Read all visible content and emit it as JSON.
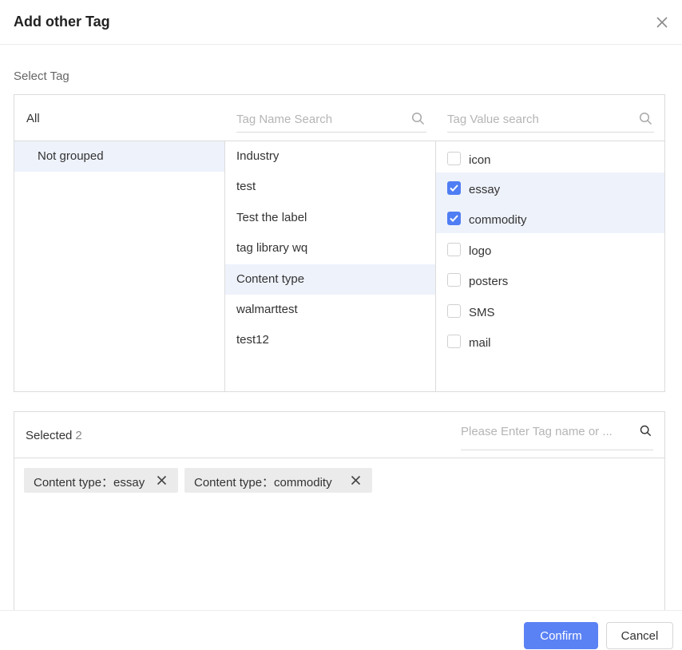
{
  "dialog": {
    "title": "Add other Tag",
    "close_icon": "close-icon"
  },
  "select_tag": {
    "label": "Select Tag",
    "all_label": "All",
    "name_search_placeholder": "Tag Name Search",
    "value_search_placeholder": "Tag Value search",
    "groups": [
      {
        "label": "Not grouped",
        "active": true
      }
    ],
    "tag_names": [
      {
        "label": "Industry",
        "active": false
      },
      {
        "label": "test",
        "active": false
      },
      {
        "label": "Test the label",
        "active": false
      },
      {
        "label": "tag library wq",
        "active": false
      },
      {
        "label": "Content type",
        "active": true
      },
      {
        "label": "walmarttest",
        "active": false
      },
      {
        "label": "test12",
        "active": false
      }
    ],
    "tag_values": [
      {
        "label": "icon",
        "checked": false
      },
      {
        "label": "essay",
        "checked": true
      },
      {
        "label": "commodity",
        "checked": true
      },
      {
        "label": "logo",
        "checked": false
      },
      {
        "label": "posters",
        "checked": false
      },
      {
        "label": "SMS",
        "checked": false
      },
      {
        "label": "mail",
        "checked": false
      }
    ]
  },
  "selected": {
    "title": "Selected",
    "count": "2",
    "search_placeholder": "Please Enter Tag name or ...",
    "chips": [
      {
        "label": "Content type：essay"
      },
      {
        "label": "Content type：commodity"
      }
    ]
  },
  "footer": {
    "confirm_label": "Confirm",
    "cancel_label": "Cancel"
  },
  "colors": {
    "accent": "#5b82f4",
    "highlight_bg": "#eef2fb",
    "chip_bg": "#ebebeb"
  }
}
